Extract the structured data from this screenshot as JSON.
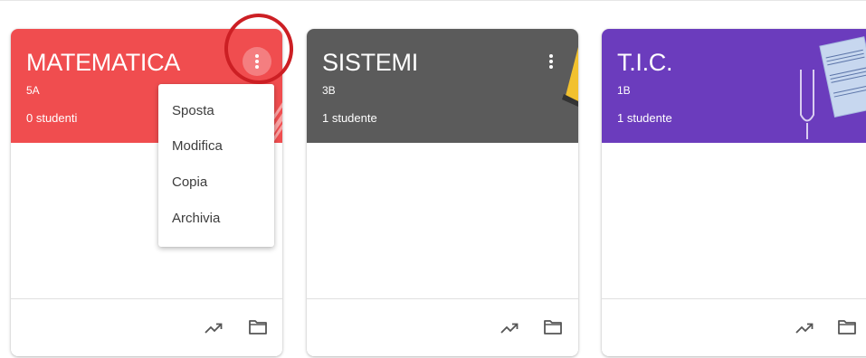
{
  "cards": [
    {
      "title": "MATEMATICA",
      "section": "5A",
      "students": "0 studenti",
      "color": "#f04d4f"
    },
    {
      "title": "SISTEMI",
      "section": "3B",
      "students": "1 studente",
      "color": "#5b5b5b"
    },
    {
      "title": "T.I.C.",
      "section": "1B",
      "students": "1 studente",
      "color": "#6b3cbd"
    }
  ],
  "menu": {
    "items": [
      "Sposta",
      "Modifica",
      "Copia",
      "Archivia"
    ]
  },
  "icons": {
    "more": "more-vert-icon",
    "trend": "trending-up-icon",
    "folder": "folder-icon"
  },
  "colors": {
    "annotation_ring": "#cc1f24"
  }
}
